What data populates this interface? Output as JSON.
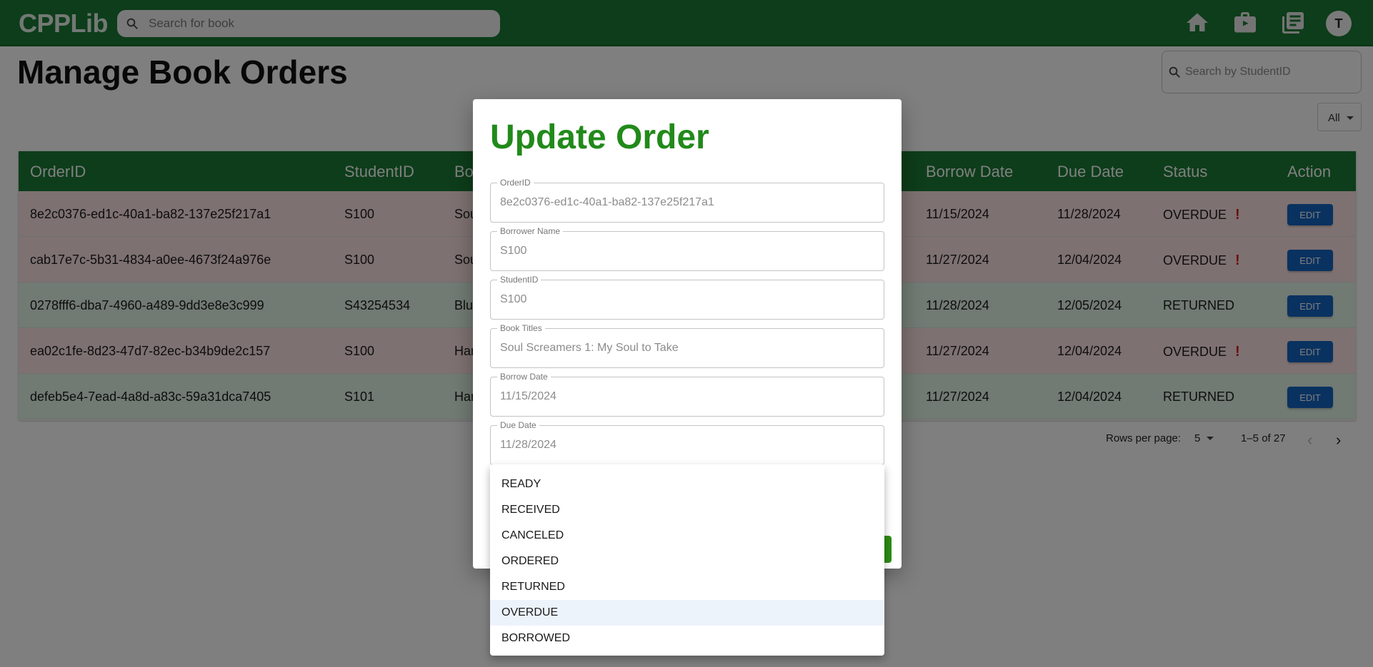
{
  "app": {
    "brand": "CPPLib",
    "search_placeholder": "Search for book",
    "avatar_letter": "T"
  },
  "nav_icons": [
    "home-icon",
    "work-icon",
    "library-icon"
  ],
  "page": {
    "title": "Manage Book Orders",
    "student_search_placeholder": "Search by StudentID",
    "filter_value": "All"
  },
  "table": {
    "columns": [
      "OrderID",
      "StudentID",
      "Bo",
      "Borrow Date",
      "Due Date",
      "Status",
      "Action"
    ],
    "rows": [
      {
        "order_id": "8e2c0376-ed1c-40a1-ba82-137e25f217a1",
        "student_id": "S100",
        "book": "Sou",
        "borrow_date": "11/15/2024",
        "due_date": "11/28/2024",
        "status": "OVERDUE",
        "action": "EDIT"
      },
      {
        "order_id": "cab17e7c-5b31-4834-a0ee-4673f24a976e",
        "student_id": "S100",
        "book": "Sou",
        "borrow_date": "11/27/2024",
        "due_date": "12/04/2024",
        "status": "OVERDUE",
        "action": "EDIT"
      },
      {
        "order_id": "0278fff6-dba7-4960-a489-9dd3e8e3c999",
        "student_id": "S43254534",
        "book": "Blu",
        "borrow_date": "11/28/2024",
        "due_date": "12/05/2024",
        "status": "RETURNED",
        "action": "EDIT"
      },
      {
        "order_id": "ea02c1fe-8d23-47d7-82ec-b34b9de2c157",
        "student_id": "S100",
        "book": "Har",
        "borrow_date": "11/27/2024",
        "due_date": "12/04/2024",
        "status": "OVERDUE",
        "action": "EDIT"
      },
      {
        "order_id": "defeb5e4-7ead-4a8d-a83c-59a31dca7405",
        "student_id": "S101",
        "book": "Har",
        "borrow_date": "11/27/2024",
        "due_date": "12/04/2024",
        "status": "RETURNED",
        "action": "EDIT"
      }
    ],
    "warning_mark": "!"
  },
  "pagination": {
    "rows_per_page_label": "Rows per page:",
    "rows_per_page": "5",
    "range": "1–5 of 27"
  },
  "dialog": {
    "title": "Update Order",
    "fields": [
      {
        "label": "OrderID",
        "value": "8e2c0376-ed1c-40a1-ba82-137e25f217a1"
      },
      {
        "label": "Borrower Name",
        "value": "S100"
      },
      {
        "label": "StudentID",
        "value": "S100"
      },
      {
        "label": "Book Titles",
        "value": "Soul Screamers 1: My Soul to Take"
      },
      {
        "label": "Borrow Date",
        "value": "11/15/2024"
      },
      {
        "label": "Due Date",
        "value": "11/28/2024"
      }
    ]
  },
  "status_menu": {
    "options": [
      "READY",
      "RECEIVED",
      "CANCELED",
      "ORDERED",
      "RETURNED",
      "OVERDUE",
      "BORROWED"
    ],
    "selected": "OVERDUE"
  },
  "colors": {
    "header_green": "#1b7a34",
    "title_green": "#218a1a",
    "overdue_row": "#fde3e3",
    "returned_row": "#e2f4e6",
    "edit_blue": "#1565c0",
    "warning_red": "#d21f1f"
  }
}
